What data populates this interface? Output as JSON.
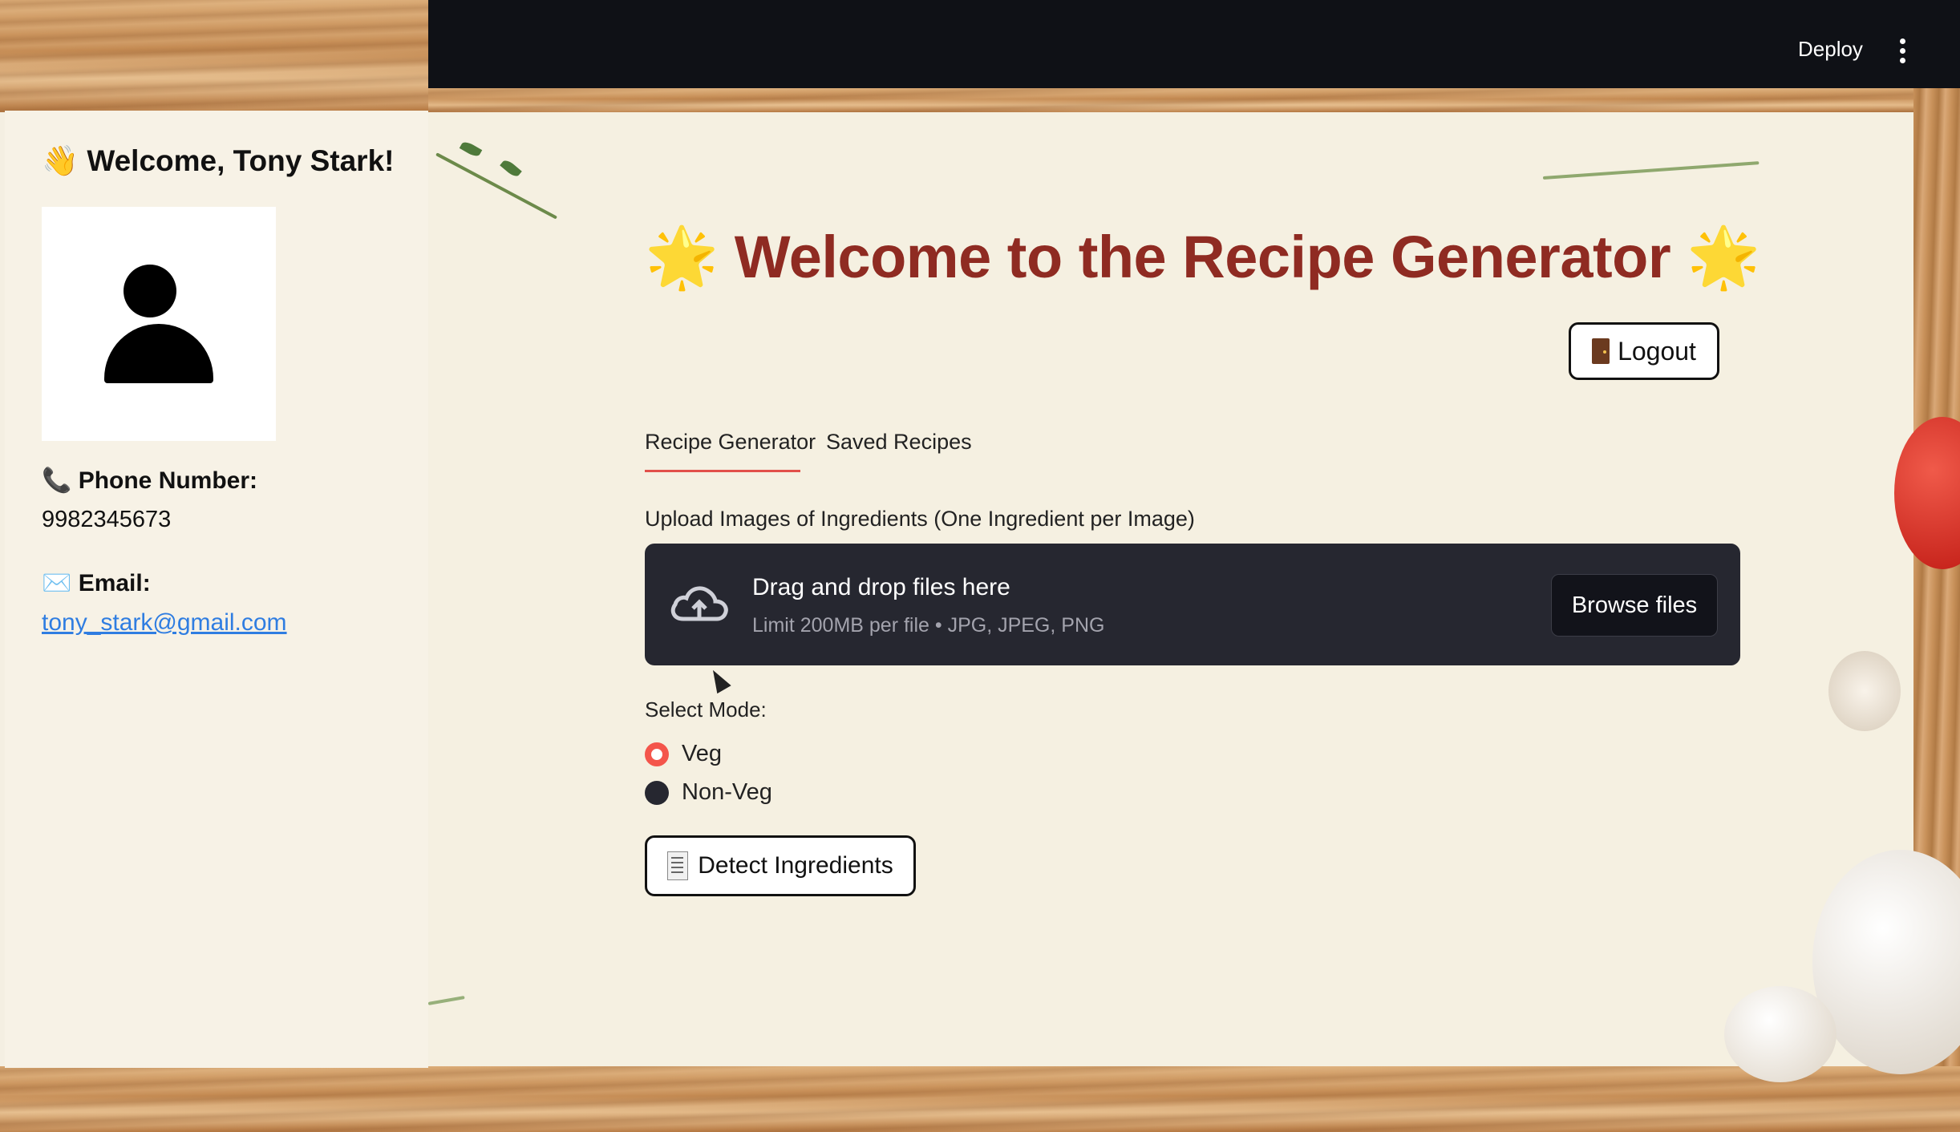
{
  "header": {
    "deploy_label": "Deploy"
  },
  "sidebar": {
    "welcome": "👋 Welcome, Tony Stark!",
    "phone_label": "📞 Phone Number:",
    "phone_value": "9982345673",
    "email_label": "✉️ Email:",
    "email_value": "tony_stark@gmail.com"
  },
  "main": {
    "title": "Welcome to the Recipe Generator",
    "title_star": "🌟",
    "logout_label": "Logout",
    "tabs": [
      {
        "label": "Recipe Generator",
        "active": true
      },
      {
        "label": "Saved Recipes",
        "active": false
      }
    ],
    "upload": {
      "label": "Upload Images of Ingredients (One Ingredient per Image)",
      "dropzone_title": "Drag and drop files here",
      "dropzone_sub": "Limit 200MB per file • JPG, JPEG, PNG",
      "browse_label": "Browse files"
    },
    "mode": {
      "label": "Select Mode:",
      "options": [
        {
          "label": "Veg",
          "selected": true
        },
        {
          "label": "Non-Veg",
          "selected": false
        }
      ]
    },
    "detect_label": "Detect Ingredients"
  },
  "colors": {
    "title": "#8f2b22",
    "accent": "#f4554b",
    "dropzone_bg": "#262730",
    "topbar_bg": "#0f1116",
    "link": "#2f7de1"
  }
}
